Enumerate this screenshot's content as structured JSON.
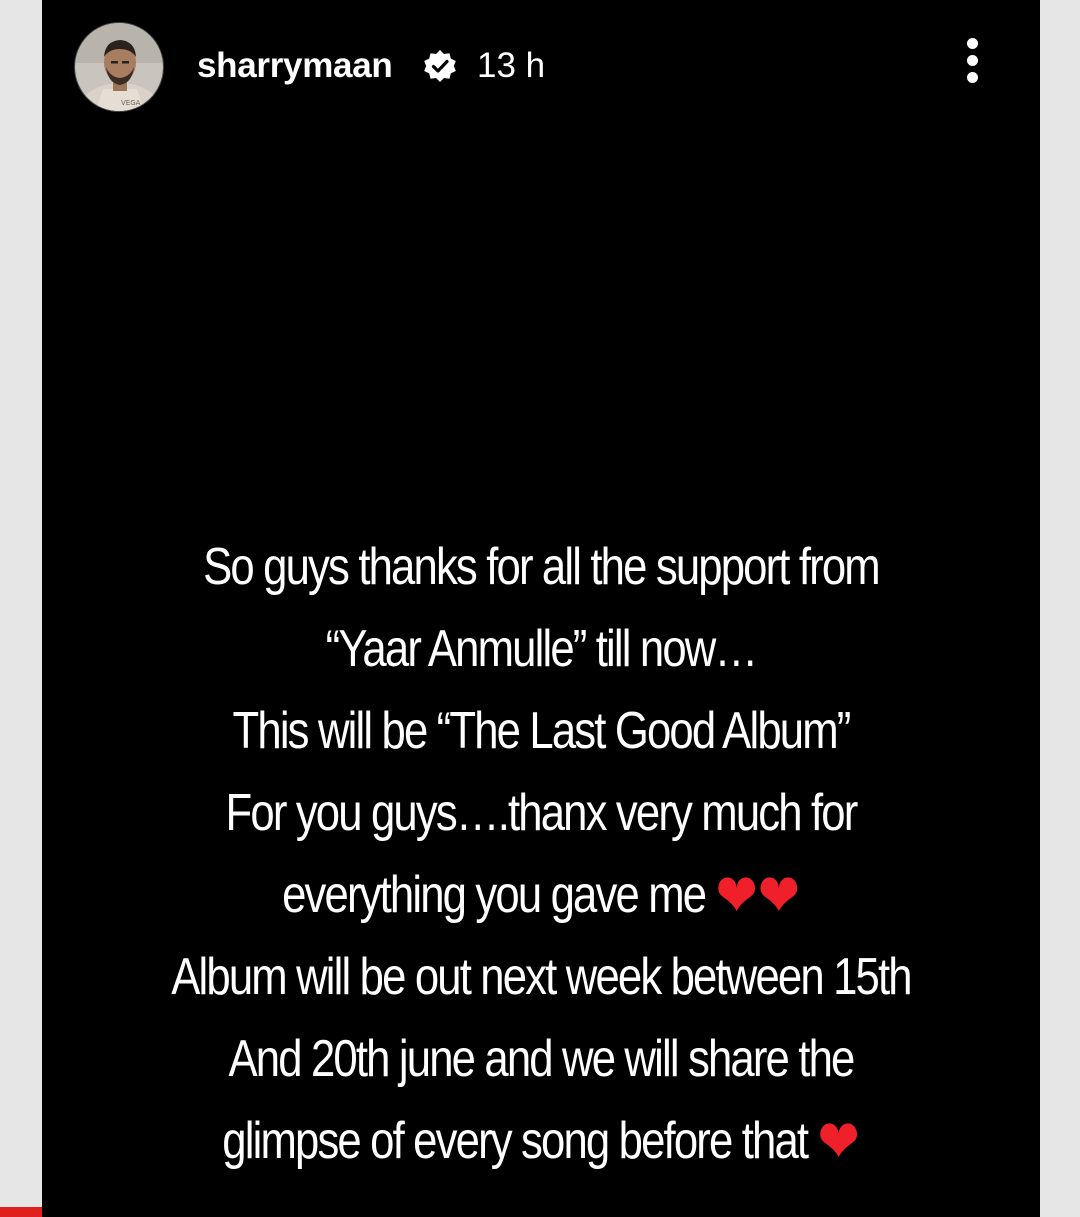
{
  "story": {
    "username": "sharrymaan",
    "time": "13 h",
    "verified_icon": "verified-badge-icon",
    "more_icon": "more-vertical-icon"
  },
  "caption": {
    "lines": [
      "So guys thanks for all the support from",
      "“Yaar Anmulle” till now…",
      "This will be “The Last Good Album”",
      "For you guys….thanx very much for",
      "everything you gave me",
      "Album will be out next week between 15th",
      "And 20th june and we will share the",
      "glimpse of every song before that"
    ],
    "hearts_line5": "❤❤",
    "hearts_line8": "❤"
  },
  "colors": {
    "background": "#000000",
    "text": "#ffffff",
    "heart": "#f0202a",
    "frame": "#e6e6e7",
    "edge_badge": "#e0201c"
  }
}
